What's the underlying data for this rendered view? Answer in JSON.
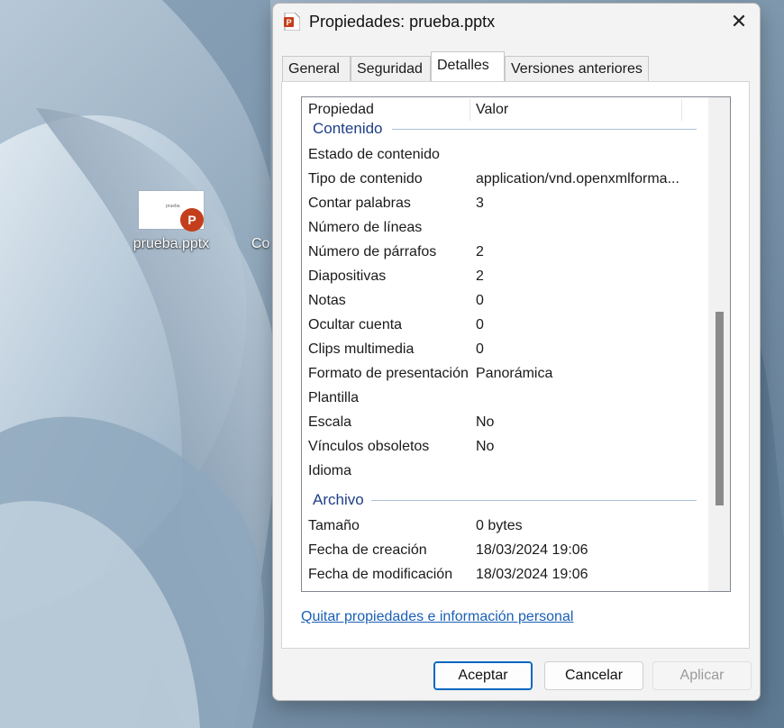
{
  "desktop": {
    "icon_label": "prueba.pptx",
    "thumb_text": "prueba",
    "badge_letter": "P",
    "partial_label": "Co"
  },
  "dialog": {
    "title": "Propiedades: prueba.pptx",
    "close_glyph": "✕",
    "tabs": [
      {
        "label": "General"
      },
      {
        "label": "Seguridad"
      },
      {
        "label": "Detalles"
      },
      {
        "label": "Versiones anteriores"
      }
    ],
    "active_tab": "Detalles",
    "columns": {
      "property": "Propiedad",
      "value": "Valor"
    },
    "groups": [
      {
        "name": "Contenido"
      },
      {
        "name": "Archivo"
      }
    ],
    "rows": [
      {
        "k": "Estado de contenido",
        "v": ""
      },
      {
        "k": "Tipo de contenido",
        "v": "application/vnd.openxmlforma..."
      },
      {
        "k": "Contar palabras",
        "v": "3"
      },
      {
        "k": "Número de líneas",
        "v": ""
      },
      {
        "k": "Número de párrafos",
        "v": "2"
      },
      {
        "k": "Diapositivas",
        "v": "2"
      },
      {
        "k": "Notas",
        "v": "0"
      },
      {
        "k": "Ocultar cuenta",
        "v": "0"
      },
      {
        "k": "Clips multimedia",
        "v": "0"
      },
      {
        "k": "Formato de presentación",
        "v": "Panorámica"
      },
      {
        "k": "Plantilla",
        "v": ""
      },
      {
        "k": "Escala",
        "v": "No"
      },
      {
        "k": "Vínculos obsoletos",
        "v": "No"
      },
      {
        "k": "Idioma",
        "v": ""
      },
      {
        "k": "Tamaño",
        "v": "0 bytes"
      },
      {
        "k": "Fecha de creación",
        "v": "18/03/2024 19:06"
      },
      {
        "k": "Fecha de modificación",
        "v": "18/03/2024 19:06"
      }
    ],
    "link": "Quitar propiedades e información personal",
    "buttons": {
      "ok": "Aceptar",
      "cancel": "Cancelar",
      "apply": "Aplicar"
    }
  },
  "colors": {
    "group_header": "#1e3f86",
    "link": "#1a5fb4",
    "primary_border": "#0067c0",
    "powerpoint_red": "#c43e1c"
  }
}
